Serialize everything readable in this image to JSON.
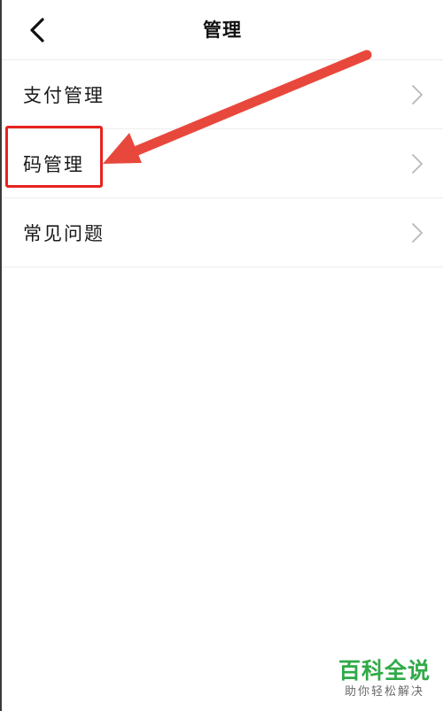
{
  "nav": {
    "title": "管理",
    "back_icon": "chevron-left-icon"
  },
  "menu": {
    "items": [
      {
        "label": "支付管理",
        "icon": "chevron-right-icon"
      },
      {
        "label": "码管理",
        "icon": "chevron-right-icon"
      },
      {
        "label": "常见问题",
        "icon": "chevron-right-icon"
      }
    ]
  },
  "annotation": {
    "highlight_color": "#e8231f",
    "arrow_color": "#e8483c"
  },
  "watermark": {
    "title": "百科全说",
    "subtitle": "助你轻松解决",
    "color": "#2faa47"
  }
}
